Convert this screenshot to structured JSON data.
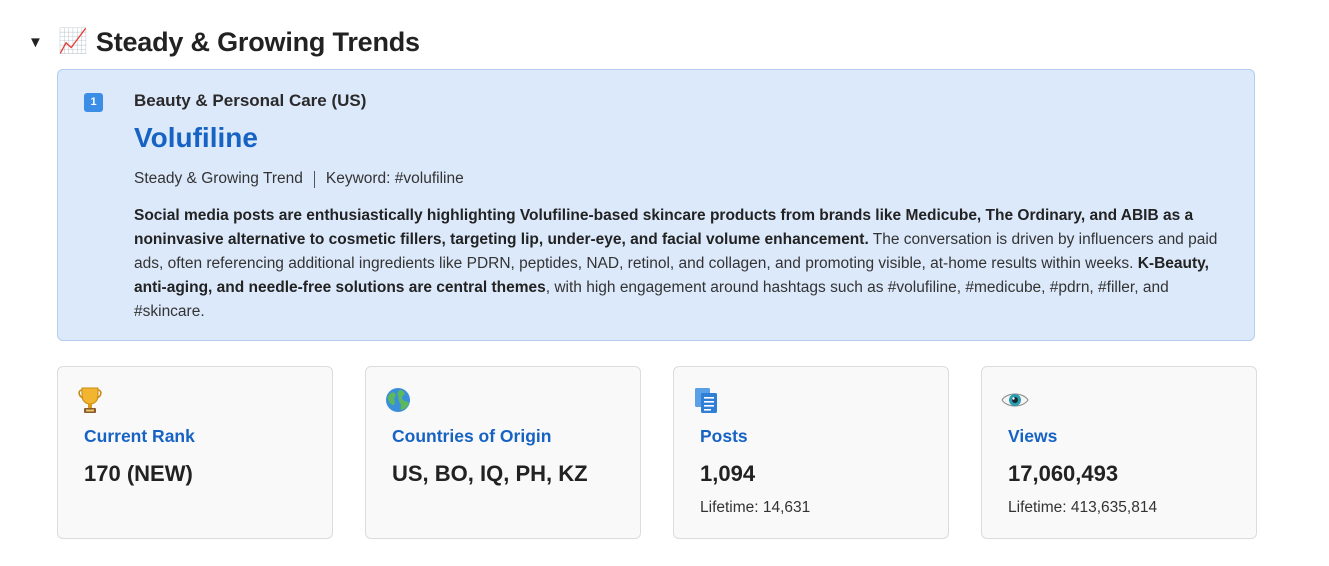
{
  "section": {
    "caret": "▼",
    "emoji": "📈",
    "title": "Steady & Growing Trends"
  },
  "trend": {
    "rank_badge": "1",
    "category": "Beauty & Personal Care (US)",
    "name": "Volufiline",
    "type": "Steady & Growing Trend",
    "keyword": "Keyword: #volufiline",
    "description": {
      "bold_1": "Social media posts are enthusiastically highlighting Volufiline-based skincare products from brands like Medicube, The Ordinary, and ABIB as a noninvasive alternative to cosmetic fillers, targeting lip, under-eye, and facial volume enhancement.",
      "text_1": " The conversation is driven by influencers and paid ads, often referencing additional ingredients like PDRN, peptides, NAD, retinol, and collagen, and promoting visible, at-home results within weeks. ",
      "bold_2": "K-Beauty, anti-aging, and needle-free solutions are central themes",
      "text_2": ", with high engagement around hashtags such as #volufiline, #medicube, #pdrn, #filler, and #skincare."
    }
  },
  "stats": [
    {
      "icon": "trophy-icon",
      "label": "Current Rank",
      "value": "170 (NEW)",
      "sub": ""
    },
    {
      "icon": "globe-icon",
      "label": "Countries of Origin",
      "value": "US, BO, IQ, PH, KZ",
      "sub": ""
    },
    {
      "icon": "document-icon",
      "label": "Posts",
      "value": "1,094",
      "sub": "Lifetime: 14,631"
    },
    {
      "icon": "eye-icon",
      "label": "Views",
      "value": "17,060,493",
      "sub": "Lifetime: 413,635,814"
    }
  ],
  "colors": {
    "accent": "#1763c4",
    "card_bg": "#dce9fb",
    "badge": "#3a8ee6"
  }
}
